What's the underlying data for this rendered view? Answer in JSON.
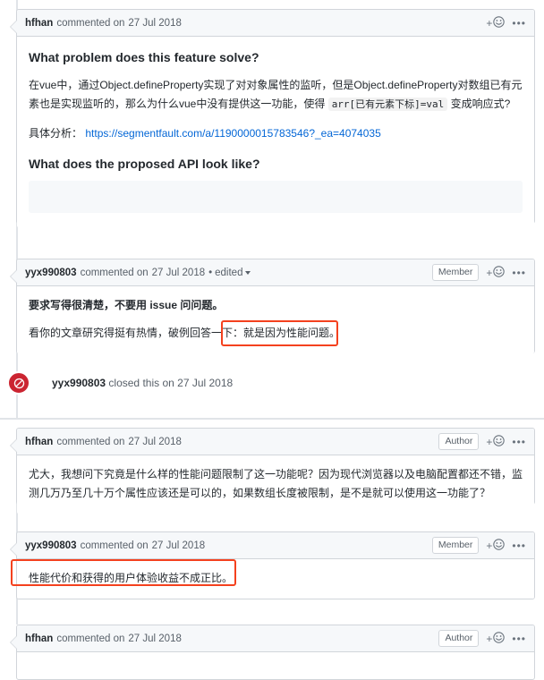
{
  "page": {
    "title": "GitHub issue comment thread"
  },
  "icons": {
    "add_reaction": "smiley-plus-icon",
    "overflow_menu": "kebab-menu-icon",
    "closed": "issue-closed-icon",
    "edited_caret": "chevron-down-icon"
  },
  "colors": {
    "closed_red": "#cb2431",
    "annotation_red": "#f4411e",
    "link_blue": "#0366d6",
    "header_bg": "#f6f8fa",
    "border": "#d1d5da"
  },
  "common": {
    "commented_text": "commented on",
    "date": "27 Jul 2018",
    "edited_label": "edited",
    "edited_separator": "•",
    "plus": "+"
  },
  "badges": {
    "member": "Member",
    "author": "Author"
  },
  "comments": [
    {
      "author": "hfhan",
      "action": "commented on",
      "date": "27 Jul 2018",
      "badge": "",
      "edited": false,
      "body": {
        "heading1": "What problem does this feature solve?",
        "paragraph1_part1": "在vue中，通过Object.defineProperty实现了对对象属性的监听，但是Object.defineProperty对数组已有元素也是实现监听的，那么为什么vue中没有提供这一功能，使得 ",
        "paragraph1_code": "arr[已有元素下标]=val",
        "paragraph1_part2": " 变成响应式?",
        "paragraph2_label": "具体分析：",
        "paragraph2_link": "https://segmentfault.com/a/1190000015783546?_ea=4074035",
        "heading2": "What does the proposed API look like?",
        "codeblock": ""
      }
    },
    {
      "author": "yyx990803",
      "action": "commented on",
      "date": "27 Jul 2018",
      "badge": "Member",
      "edited": true,
      "body": {
        "paragraph1": "要求写得很清楚，不要用 issue 问问题。",
        "paragraph2_prefix": "看你的文章研究得挺有热情，破例回答一下：",
        "paragraph2_highlight": "就是因为性能问题。"
      }
    },
    {
      "author": "hfhan",
      "action": "commented on",
      "date": "27 Jul 2018",
      "badge": "Author",
      "edited": false,
      "body": {
        "paragraph1": "尤大，我想问下究竟是什么样的性能问题限制了这一功能呢？因为现代浏览器以及电脑配置都还不错，监测几万乃至几十万个属性应该还是可以的，如果数组长度被限制，是不是就可以使用这一功能了？"
      }
    },
    {
      "author": "yyx990803",
      "action": "commented on",
      "date": "27 Jul 2018",
      "badge": "Member",
      "edited": false,
      "body": {
        "paragraph1": "性能代价和获得的用户体验收益不成正比。"
      }
    },
    {
      "author": "hfhan",
      "action": "commented on",
      "date": "27 Jul 2018",
      "badge": "Author",
      "edited": false,
      "body": {}
    }
  ],
  "event": {
    "actor": "yyx990803",
    "text": "closed this on",
    "date": "27 Jul 2018"
  }
}
